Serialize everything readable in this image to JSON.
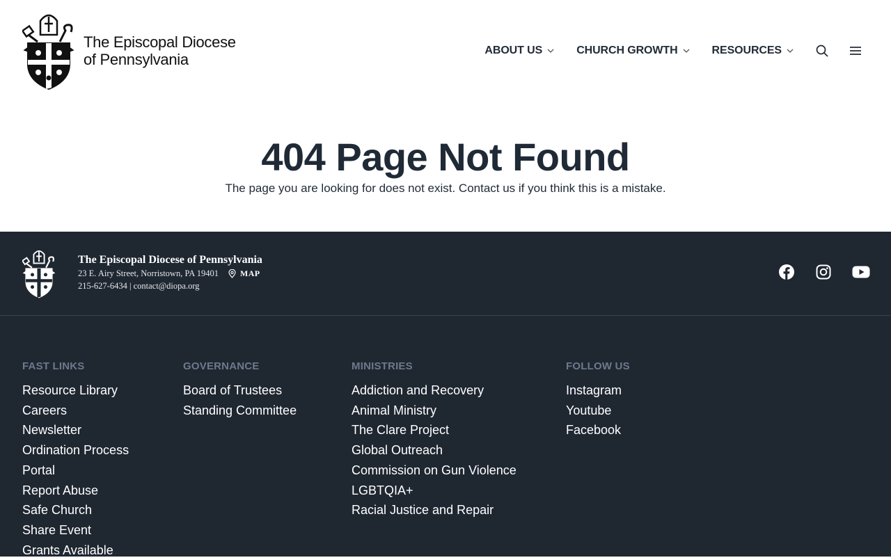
{
  "header": {
    "logo_line1": "The Episcopal Diocese",
    "logo_line2": "of Pennsylvania",
    "nav": [
      {
        "label": "ABOUT US"
      },
      {
        "label": "CHURCH GROWTH"
      },
      {
        "label": "RESOURCES"
      }
    ],
    "icons": [
      "search-icon",
      "hamburger-menu-icon",
      "chevron-down-icon"
    ]
  },
  "main": {
    "title": "404 Page Not Found",
    "message": "The page you are looking for does not exist. Contact us if you think this is a mistake."
  },
  "footer": {
    "org_name": "The Episcopal Diocese of Pennsylvania",
    "address": "23 E. Airy Street, Norristown, PA 19401",
    "map_label": "MAP",
    "contact": "215-627-6434 | contact@diopa.org",
    "social_icons": [
      "facebook-icon",
      "instagram-icon",
      "youtube-icon"
    ],
    "columns": [
      {
        "heading": "FAST LINKS",
        "links": [
          "Resource Library",
          "Careers",
          "Newsletter",
          "Ordination Process",
          "Portal",
          "Report Abuse",
          "Safe Church",
          "Share Event",
          "Grants Available"
        ]
      },
      {
        "heading": "GOVERNANCE",
        "links": [
          "Board of Trustees",
          "Standing Committee"
        ]
      },
      {
        "heading": "MINISTRIES",
        "links": [
          "Addiction and Recovery",
          "Animal Ministry",
          "The Clare Project",
          "Global Outreach",
          "Commission on Gun Violence",
          "LGBTQIA+",
          "Racial Justice and Repair"
        ]
      },
      {
        "heading": "FOLLOW US",
        "links": [
          "Instagram",
          "Youtube",
          "Facebook"
        ]
      }
    ]
  },
  "colors": {
    "text_dark": "#1f2a36",
    "footer_bg": "#1f2731",
    "footer_heading": "#6b7a8c",
    "footer_link": "#ffffff"
  }
}
